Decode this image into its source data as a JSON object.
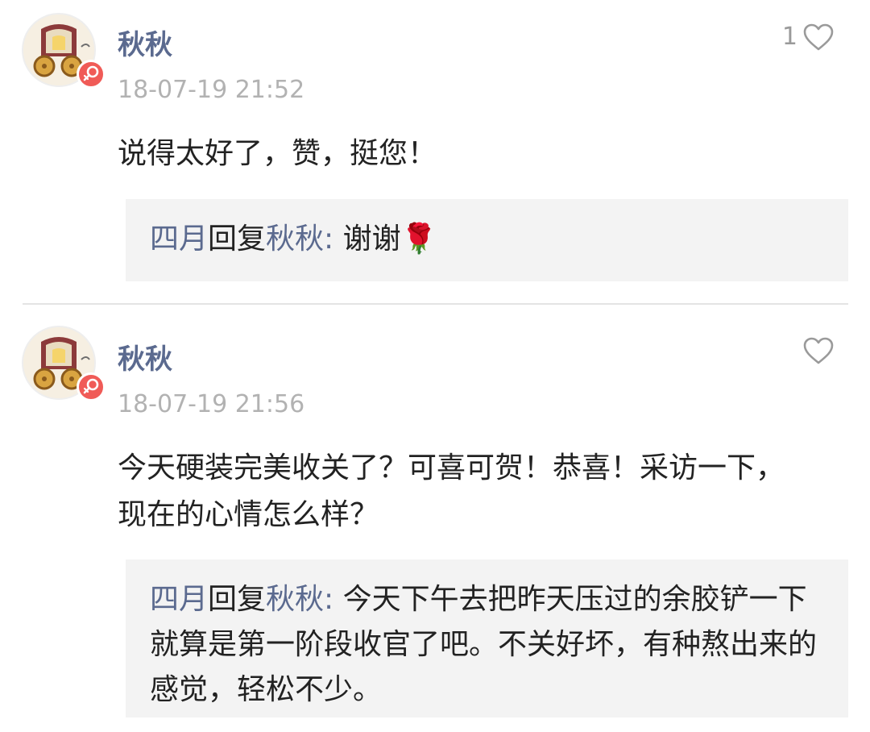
{
  "comments": [
    {
      "username": "秋秋",
      "time": "18-07-19 21:52",
      "like_count": "1",
      "text": "说得太好了，赞，挺您！",
      "reply": {
        "from": "四月",
        "verb": "回复",
        "to": "秋秋",
        "colon": ":",
        "text": "谢谢🌹"
      }
    },
    {
      "username": "秋秋",
      "time": "18-07-19 21:56",
      "like_count": "",
      "text": "今天硬装完美收关了？可喜可贺！恭喜！采访一下，现在的心情怎么样？",
      "reply": {
        "from": "四月",
        "verb": "回复",
        "to": "秋秋",
        "colon": ":",
        "text": "今天下午去把昨天压过的余胶铲一下就算是第一阶段收官了吧。不关好坏，有种熬出来的感觉，轻松不少。"
      }
    }
  ],
  "icons": {
    "like": "heart-outline-icon",
    "gender": "female-icon"
  },
  "colors": {
    "username": "#5b6a8f",
    "timestamp": "#b2b2b2",
    "reply_background": "#f3f3f3",
    "gender_badge": "#f05b57"
  }
}
